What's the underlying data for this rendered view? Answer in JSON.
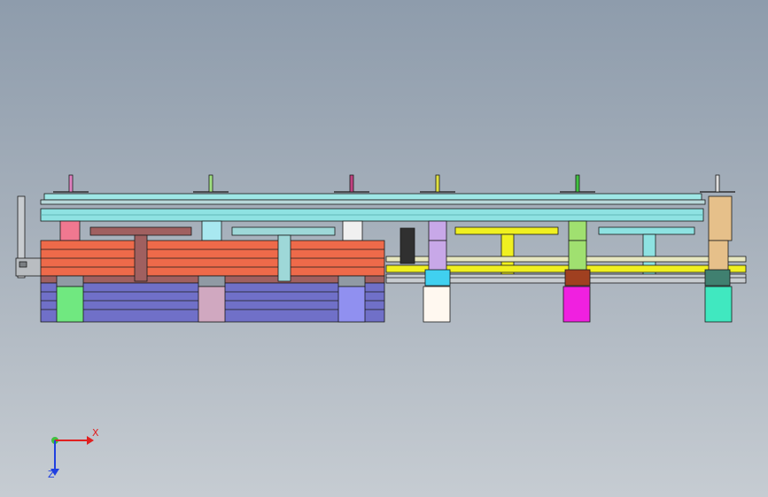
{
  "viewport": {
    "background_top": "#8e9cac",
    "background_bottom": "#c6ccd2"
  },
  "triad": {
    "x_label": "X",
    "z_label": "Z",
    "x_color": "#e02020",
    "y_color": "#20b020",
    "z_color": "#2040e0"
  }
}
